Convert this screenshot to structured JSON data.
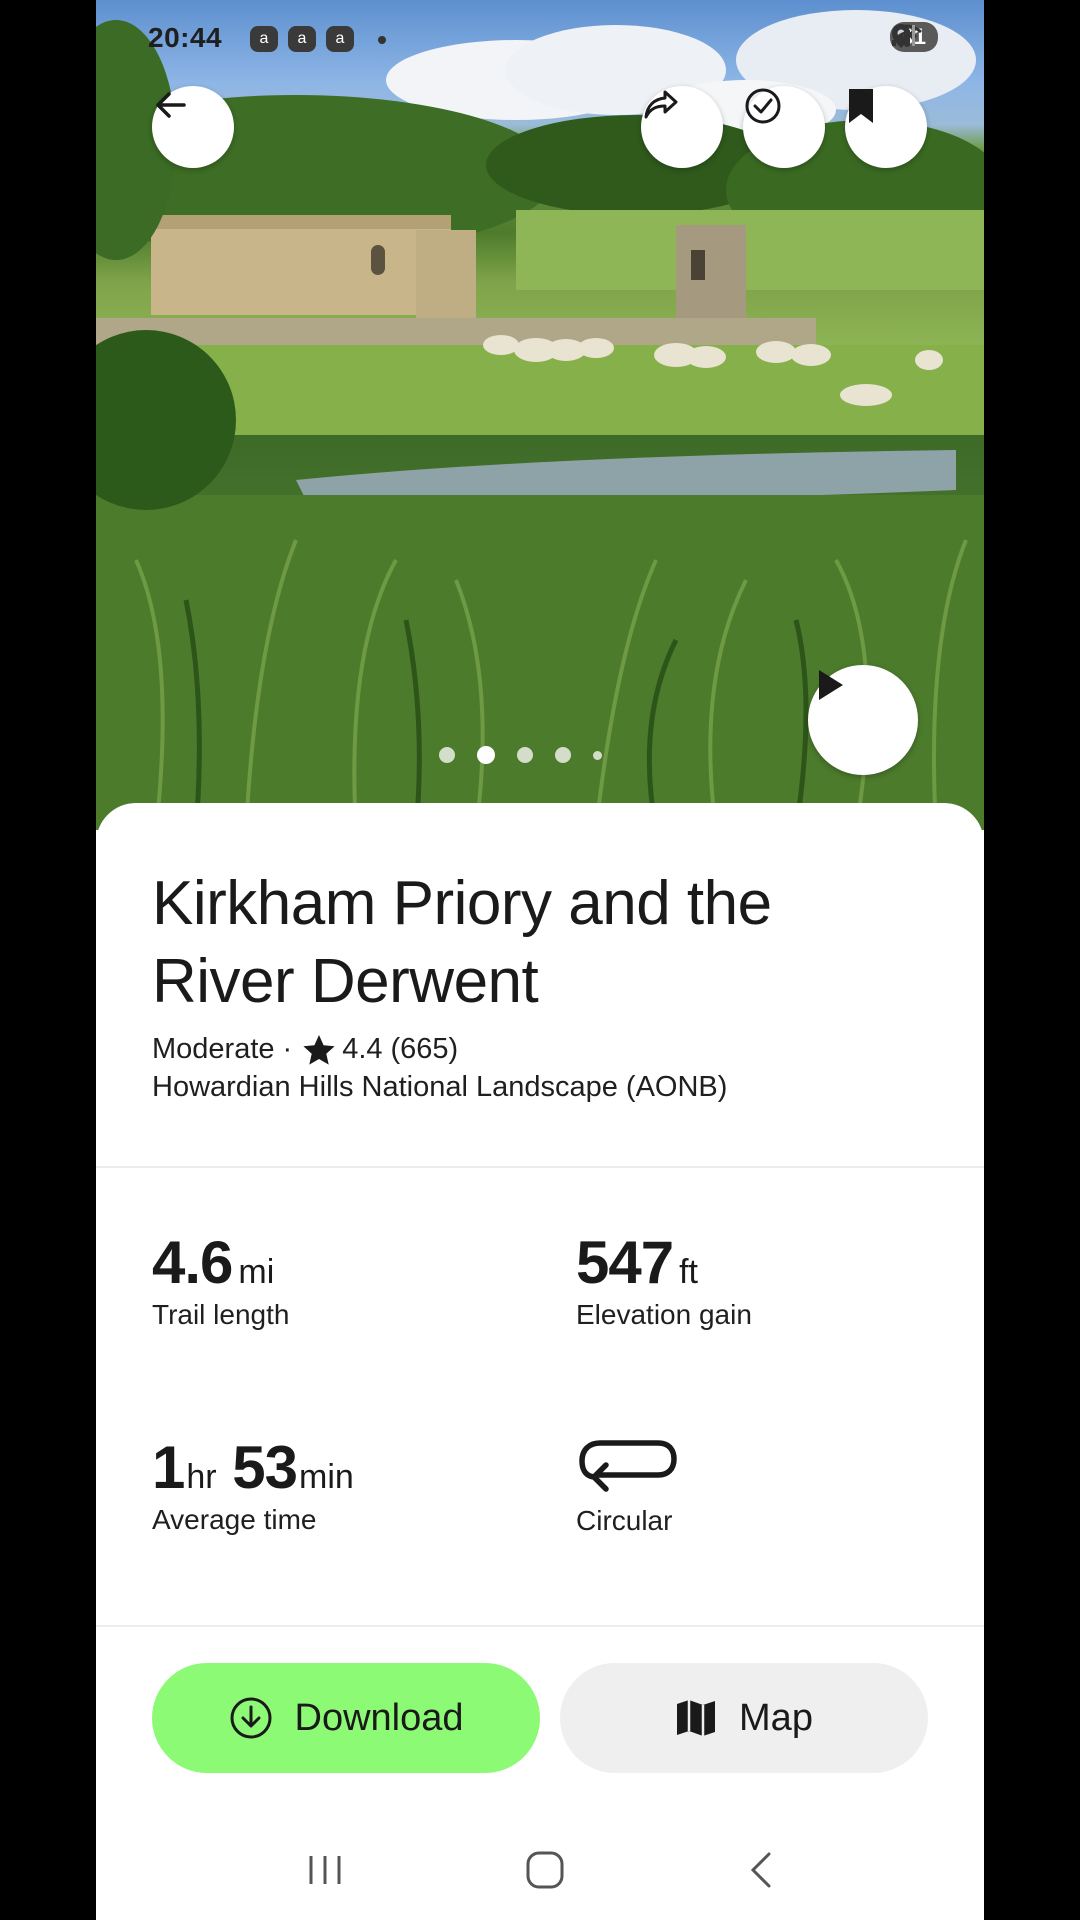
{
  "status_bar": {
    "time": "20:44",
    "notifications": [
      "a",
      "a",
      "a"
    ],
    "battery": "61",
    "icons": [
      "mute-icon",
      "location-icon",
      "wifi-icon",
      "signal-icon"
    ]
  },
  "hero": {
    "image_dots": [
      false,
      true,
      false,
      false,
      false
    ],
    "play_icon": "play-icon"
  },
  "trail": {
    "title": "Kirkham Priory and the River Derwent",
    "difficulty": "Moderate",
    "separator": "·",
    "rating": "4.4",
    "reviews": "(665)",
    "region": "Howardian Hills National Landscape (AONB)"
  },
  "stats": {
    "length": {
      "value": "4.6",
      "unit": "mi",
      "label": "Trail length"
    },
    "elevation": {
      "value": "547",
      "unit": "ft",
      "label": "Elevation gain"
    },
    "time": {
      "hours": "1",
      "hours_unit": "hr",
      "minutes": "53",
      "minutes_unit": "min",
      "label": "Average time"
    },
    "route": {
      "label": "Circular",
      "icon": "loop-icon"
    }
  },
  "actions": {
    "download_label": "Download",
    "map_label": "Map"
  },
  "colors": {
    "download_bg": "#8dfa76",
    "map_bg": "#efefef",
    "text": "#1a1a1a"
  }
}
